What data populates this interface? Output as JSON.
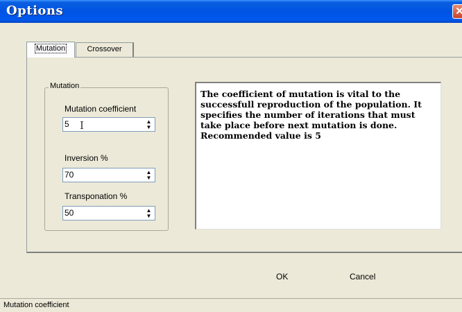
{
  "window": {
    "title": "Options",
    "close_glyph": "✕"
  },
  "tabs": [
    {
      "label": "Mutation",
      "selected": true
    },
    {
      "label": "Crossover",
      "selected": false
    }
  ],
  "group": {
    "legend": "Mutation",
    "fields": [
      {
        "label": "Mutation coefficient",
        "value": "5"
      },
      {
        "label": "Inversion %",
        "value": "70"
      },
      {
        "label": "Transponation %",
        "value": "50"
      }
    ]
  },
  "description": "The coefficient of mutation is vital to the successfull reproduction of the population.  It specifies the number of iterations that must take place before next mutation is done. Recommended value is 5",
  "buttons": {
    "ok": "OK",
    "cancel": "Cancel"
  },
  "statusbar": {
    "text": "Mutation coefficient"
  },
  "icons": {
    "spin_up": "▲",
    "spin_down": "▼",
    "text_cursor": "I"
  },
  "colors": {
    "titlebar": "#0054e3",
    "dialog_bg": "#ECE9D8"
  }
}
